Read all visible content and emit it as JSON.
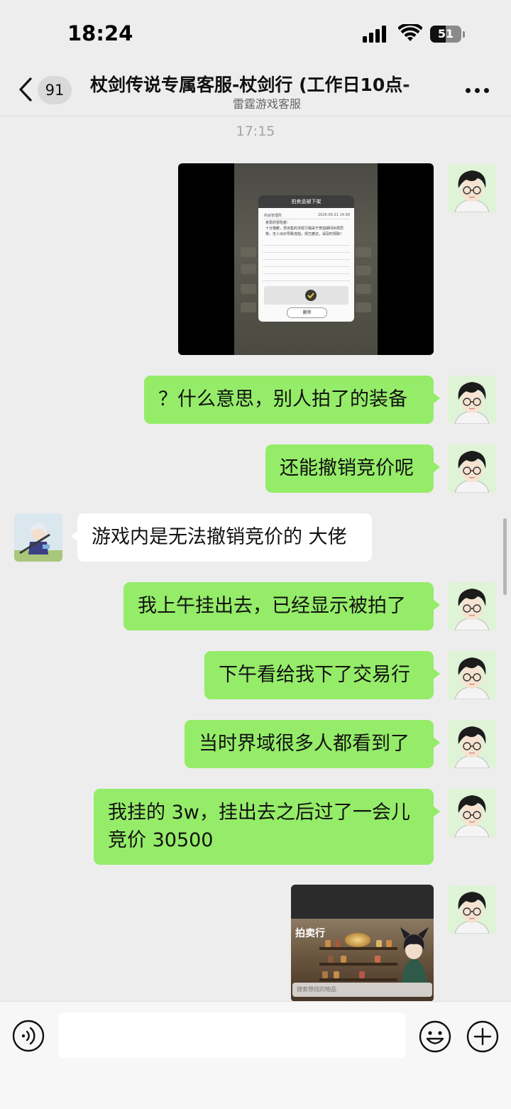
{
  "status_bar": {
    "time": "18:24",
    "battery": "51"
  },
  "nav": {
    "unread_count": "91",
    "title": "杖剑传说专属客服-杖剑行 (工作日10点-",
    "subtitle": "雷霆游戏客服"
  },
  "chat": {
    "timestamp": "17:15",
    "messages": [
      {
        "side": "out",
        "type": "image",
        "text": ""
      },
      {
        "side": "out",
        "type": "text",
        "text": "？什么意思，别人拍了的装备"
      },
      {
        "side": "out",
        "type": "text",
        "text": "还能撤销竞价呢"
      },
      {
        "side": "in",
        "type": "text",
        "text": "游戏内是无法撤销竞价的 大佬"
      },
      {
        "side": "out",
        "type": "text",
        "text": "我上午挂出去，已经显示被拍了"
      },
      {
        "side": "out",
        "type": "text",
        "text": "下午看给我下了交易行"
      },
      {
        "side": "out",
        "type": "text",
        "text": "当时界域很多人都看到了"
      },
      {
        "side": "out",
        "type": "text",
        "text": "我挂的 3w，挂出去之后过了一会儿竞价 30500"
      },
      {
        "side": "out",
        "type": "image",
        "text": ""
      }
    ]
  },
  "image_1": {
    "dialog_title": "拍卖品被下架",
    "sender": "商会管理所",
    "date": "2026-00-21 14:56",
    "body": "亲爱的冒险者：\n十分抱歉，您出售的法杖行载由于竞拍期间出现异常，无人出价导致流拍，现已撤还，请及时领取！",
    "button": "删除"
  },
  "image_2": {
    "title": "拍卖行",
    "search_placeholder": "搜索想找的物品"
  },
  "input": {
    "placeholder": ""
  },
  "colors": {
    "bubble_out": "#95ec69",
    "bubble_in": "#ffffff",
    "background": "#ededed"
  },
  "icons": [
    "back-icon",
    "more-icon",
    "voice-icon",
    "emoji-icon",
    "plus-icon",
    "signal-icon",
    "wifi-icon",
    "battery-icon"
  ]
}
